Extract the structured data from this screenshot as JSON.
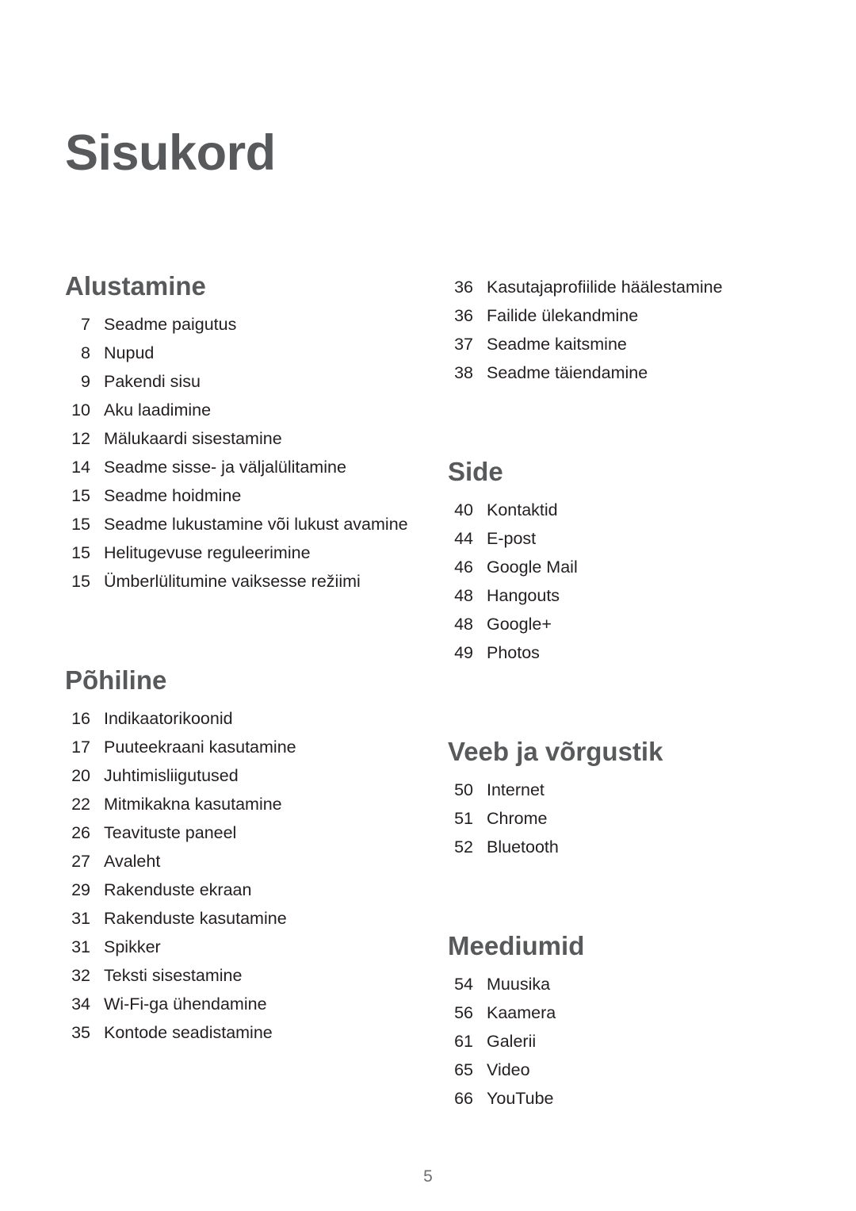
{
  "document": {
    "title": "Sisukord",
    "page_number": "5"
  },
  "colors": {
    "heading": "#58595b",
    "body_text": "#231f20",
    "page_number": "#6d6e71",
    "background": "#ffffff"
  },
  "left_column": {
    "sections": [
      {
        "heading": "Alustamine",
        "entries": [
          {
            "page": "7",
            "label": "Seadme paigutus"
          },
          {
            "page": "8",
            "label": "Nupud"
          },
          {
            "page": "9",
            "label": "Pakendi sisu"
          },
          {
            "page": "10",
            "label": "Aku laadimine"
          },
          {
            "page": "12",
            "label": "Mälukaardi sisestamine"
          },
          {
            "page": "14",
            "label": "Seadme sisse- ja väljalülitamine"
          },
          {
            "page": "15",
            "label": "Seadme hoidmine"
          },
          {
            "page": "15",
            "label": "Seadme lukustamine või lukust avamine"
          },
          {
            "page": "15",
            "label": "Helitugevuse reguleerimine"
          },
          {
            "page": "15",
            "label": "Ümberlülitumine vaiksesse režiimi"
          }
        ]
      },
      {
        "heading": "Põhiline",
        "entries": [
          {
            "page": "16",
            "label": "Indikaatorikoonid"
          },
          {
            "page": "17",
            "label": "Puuteekraani kasutamine"
          },
          {
            "page": "20",
            "label": "Juhtimisliigutused"
          },
          {
            "page": "22",
            "label": "Mitmikakna kasutamine"
          },
          {
            "page": "26",
            "label": "Teavituste paneel"
          },
          {
            "page": "27",
            "label": "Avaleht"
          },
          {
            "page": "29",
            "label": "Rakenduste ekraan"
          },
          {
            "page": "31",
            "label": "Rakenduste kasutamine"
          },
          {
            "page": "31",
            "label": "Spikker"
          },
          {
            "page": "32",
            "label": "Teksti sisestamine"
          },
          {
            "page": "34",
            "label": "Wi-Fi-ga ühendamine"
          },
          {
            "page": "35",
            "label": "Kontode seadistamine"
          }
        ]
      }
    ]
  },
  "right_column": {
    "continued_entries": [
      {
        "page": "36",
        "label": "Kasutajaprofiilide häälestamine"
      },
      {
        "page": "36",
        "label": "Failide ülekandmine"
      },
      {
        "page": "37",
        "label": "Seadme kaitsmine"
      },
      {
        "page": "38",
        "label": "Seadme täiendamine"
      }
    ],
    "sections": [
      {
        "heading": "Side",
        "entries": [
          {
            "page": "40",
            "label": "Kontaktid"
          },
          {
            "page": "44",
            "label": "E-post"
          },
          {
            "page": "46",
            "label": "Google Mail"
          },
          {
            "page": "48",
            "label": "Hangouts"
          },
          {
            "page": "48",
            "label": "Google+"
          },
          {
            "page": "49",
            "label": "Photos"
          }
        ]
      },
      {
        "heading": "Veeb ja võrgustik",
        "entries": [
          {
            "page": "50",
            "label": "Internet"
          },
          {
            "page": "51",
            "label": "Chrome"
          },
          {
            "page": "52",
            "label": "Bluetooth"
          }
        ]
      },
      {
        "heading": "Meediumid",
        "entries": [
          {
            "page": "54",
            "label": "Muusika"
          },
          {
            "page": "56",
            "label": "Kaamera"
          },
          {
            "page": "61",
            "label": "Galerii"
          },
          {
            "page": "65",
            "label": "Video"
          },
          {
            "page": "66",
            "label": "YouTube"
          }
        ]
      }
    ]
  }
}
